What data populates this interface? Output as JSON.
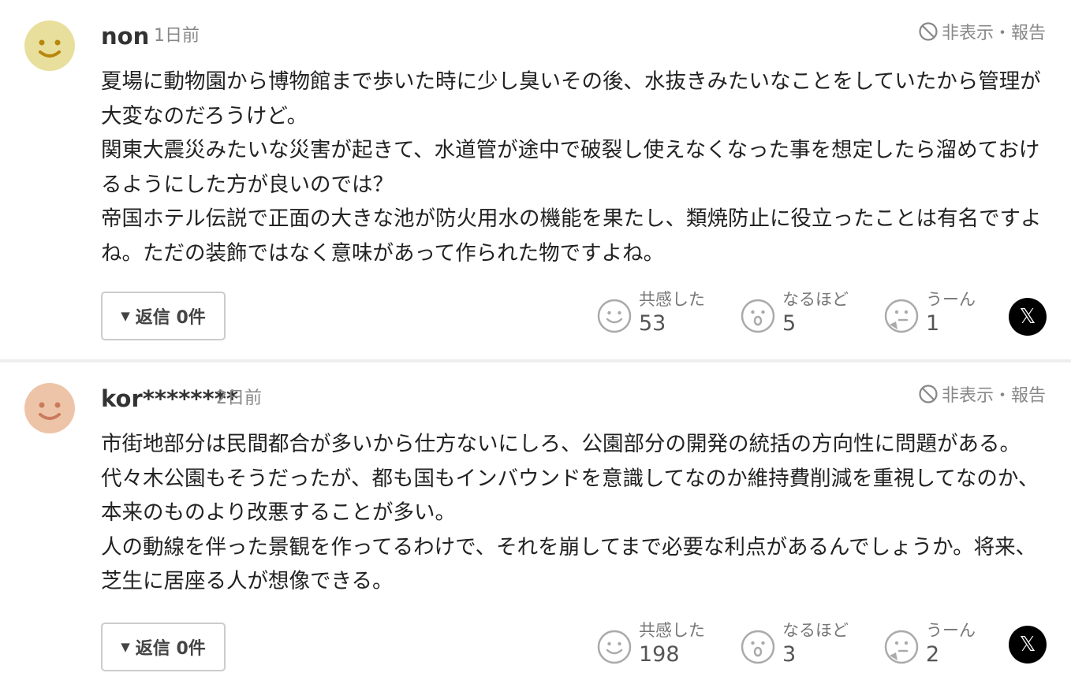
{
  "colors": {
    "avatar1": "#e8df9c",
    "avatar2": "#eec4a8",
    "face": "#b8860b",
    "face2": "#c97b5c"
  },
  "comments": [
    {
      "author": "non",
      "time": "1日前",
      "hide_report": "非表示・報告",
      "paragraphs": [
        "夏場に動物園から博物館まで歩いた時に少し臭いその後、水抜きみたいなことをしていたから管理が大変なのだろうけど。",
        "関東大震災みたいな災害が起きて、水道管が途中で破裂し使えなくなった事を想定したら溜めておけるようにした方が良いのでは？",
        "帝国ホテル伝説で正面の大きな池が防火用水の機能を果たし、類焼防止に役立ったことは有名ですよね。ただの装飾ではなく意味があって作られた物ですよね。"
      ],
      "reply_label": "返信 0件",
      "reactions": [
        {
          "label": "共感した",
          "count": "53"
        },
        {
          "label": "なるほど",
          "count": "5"
        },
        {
          "label": "うーん",
          "count": "1"
        }
      ]
    },
    {
      "author": "kor********",
      "time": "2日前",
      "hide_report": "非表示・報告",
      "paragraphs": [
        "市街地部分は民間都合が多いから仕方ないにしろ、公園部分の開発の統括の方向性に問題がある。代々木公園もそうだったが、都も国もインバウンドを意識してなのか維持費削減を重視してなのか、本来のものより改悪することが多い。",
        "人の動線を伴った景観を作ってるわけで、それを崩してまで必要な利点があるんでしょうか。将来、芝生に居座る人が想像できる。"
      ],
      "reply_label": "返信 0件",
      "reactions": [
        {
          "label": "共感した",
          "count": "198"
        },
        {
          "label": "なるほど",
          "count": "3"
        },
        {
          "label": "うーん",
          "count": "2"
        }
      ]
    }
  ],
  "share": {
    "x_icon": "x-logo-icon",
    "x_glyph": "𝕏"
  }
}
